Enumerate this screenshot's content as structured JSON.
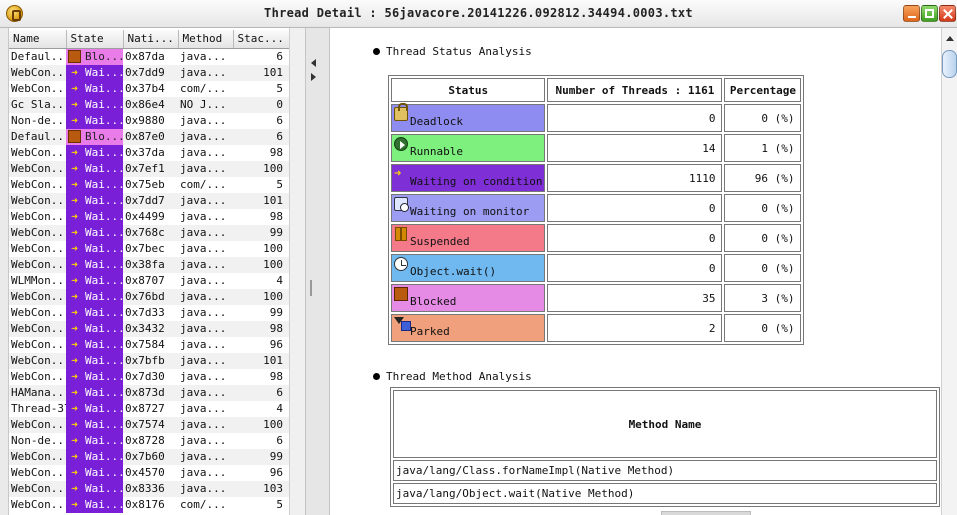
{
  "window": {
    "title": "Thread Detail : 56javacore.20141226.092812.34494.0003.txt"
  },
  "colors": {
    "blocked_state_bg": "#e97ce9",
    "waiting_state_bg": "#7a1fd8",
    "deadlock_bg": "#8f8cf1",
    "runnable_bg": "#7ef07e",
    "waiting_condition_bg": "#7f2fd6",
    "waiting_monitor_bg": "#9c9cf3",
    "suspended_bg": "#f47a8a",
    "object_wait_bg": "#6fb9f0",
    "blocked_bg": "#e58be5",
    "parked_bg": "#f0a07c"
  },
  "thread_table": {
    "columns": [
      "Name",
      "State",
      "Nati...",
      "Method",
      "Stac..."
    ],
    "rows": [
      {
        "name": "Defaul...",
        "state": "Blo...",
        "state_type": "blocked",
        "native": "0x87da",
        "method": "java...",
        "stack": "6"
      },
      {
        "name": "WebCon...",
        "state": "Wai...",
        "state_type": "waiting",
        "native": "0x7dd9",
        "method": "java...",
        "stack": "101"
      },
      {
        "name": "WebCon...",
        "state": "Wai...",
        "state_type": "waiting",
        "native": "0x37b4",
        "method": "com/...",
        "stack": "5"
      },
      {
        "name": "Gc Sla...",
        "state": "Wai...",
        "state_type": "waiting",
        "native": "0x86e4",
        "method": "NO J...",
        "stack": "0"
      },
      {
        "name": "Non-de...",
        "state": "Wai...",
        "state_type": "waiting",
        "native": "0x9880",
        "method": "java...",
        "stack": "6"
      },
      {
        "name": "Defaul...",
        "state": "Blo...",
        "state_type": "blocked",
        "native": "0x87e0",
        "method": "java...",
        "stack": "6"
      },
      {
        "name": "WebCon...",
        "state": "Wai...",
        "state_type": "waiting",
        "native": "0x37da",
        "method": "java...",
        "stack": "98"
      },
      {
        "name": "WebCon...",
        "state": "Wai...",
        "state_type": "waiting",
        "native": "0x7ef1",
        "method": "java...",
        "stack": "100"
      },
      {
        "name": "WebCon...",
        "state": "Wai...",
        "state_type": "waiting",
        "native": "0x75eb",
        "method": "com/...",
        "stack": "5"
      },
      {
        "name": "WebCon...",
        "state": "Wai...",
        "state_type": "waiting",
        "native": "0x7dd7",
        "method": "java...",
        "stack": "101"
      },
      {
        "name": "WebCon...",
        "state": "Wai...",
        "state_type": "waiting",
        "native": "0x4499",
        "method": "java...",
        "stack": "98"
      },
      {
        "name": "WebCon...",
        "state": "Wai...",
        "state_type": "waiting",
        "native": "0x768c",
        "method": "java...",
        "stack": "99"
      },
      {
        "name": "WebCon...",
        "state": "Wai...",
        "state_type": "waiting",
        "native": "0x7bec",
        "method": "java...",
        "stack": "100"
      },
      {
        "name": "WebCon...",
        "state": "Wai...",
        "state_type": "waiting",
        "native": "0x38fa",
        "method": "java...",
        "stack": "100"
      },
      {
        "name": "WLMMon...",
        "state": "Wai...",
        "state_type": "waiting",
        "native": "0x8707",
        "method": "java...",
        "stack": "4"
      },
      {
        "name": "WebCon...",
        "state": "Wai...",
        "state_type": "waiting",
        "native": "0x76bd",
        "method": "java...",
        "stack": "100"
      },
      {
        "name": "WebCon...",
        "state": "Wai...",
        "state_type": "waiting",
        "native": "0x7d33",
        "method": "java...",
        "stack": "99"
      },
      {
        "name": "WebCon...",
        "state": "Wai...",
        "state_type": "waiting",
        "native": "0x3432",
        "method": "java...",
        "stack": "98"
      },
      {
        "name": "WebCon...",
        "state": "Wai...",
        "state_type": "waiting",
        "native": "0x7584",
        "method": "java...",
        "stack": "96"
      },
      {
        "name": "WebCon...",
        "state": "Wai...",
        "state_type": "waiting",
        "native": "0x7bfb",
        "method": "java...",
        "stack": "101"
      },
      {
        "name": "WebCon...",
        "state": "Wai...",
        "state_type": "waiting",
        "native": "0x7d30",
        "method": "java...",
        "stack": "98"
      },
      {
        "name": "HAMana...",
        "state": "Wai...",
        "state_type": "waiting",
        "native": "0x873d",
        "method": "java...",
        "stack": "6"
      },
      {
        "name": "Thread-37",
        "state": "Wai...",
        "state_type": "waiting",
        "native": "0x8727",
        "method": "java...",
        "stack": "4"
      },
      {
        "name": "WebCon...",
        "state": "Wai...",
        "state_type": "waiting",
        "native": "0x7574",
        "method": "java...",
        "stack": "100"
      },
      {
        "name": "Non-de...",
        "state": "Wai...",
        "state_type": "waiting",
        "native": "0x8728",
        "method": "java...",
        "stack": "6"
      },
      {
        "name": "WebCon...",
        "state": "Wai...",
        "state_type": "waiting",
        "native": "0x7b60",
        "method": "java...",
        "stack": "99"
      },
      {
        "name": "WebCon...",
        "state": "Wai...",
        "state_type": "waiting",
        "native": "0x4570",
        "method": "java...",
        "stack": "96"
      },
      {
        "name": "WebCon...",
        "state": "Wai...",
        "state_type": "waiting",
        "native": "0x8336",
        "method": "java...",
        "stack": "103"
      },
      {
        "name": "WebCon...",
        "state": "Wai...",
        "state_type": "waiting",
        "native": "0x8176",
        "method": "com/...",
        "stack": "5"
      }
    ]
  },
  "status_analysis": {
    "heading": "Thread Status Analysis",
    "headers": {
      "status": "Status",
      "number": "Number of Threads : 1161",
      "percentage": "Percentage"
    },
    "rows": [
      {
        "label": "Deadlock",
        "icon": "lock-icon",
        "count": "0",
        "percent": "0 (%)"
      },
      {
        "label": "Runnable",
        "icon": "play-icon",
        "count": "14",
        "percent": "1 (%)"
      },
      {
        "label": "Waiting on condition",
        "icon": "arrow-right-icon",
        "count": "1110",
        "percent": "96 (%)"
      },
      {
        "label": "Waiting on monitor",
        "icon": "monitor-icon",
        "count": "0",
        "percent": "0 (%)"
      },
      {
        "label": "Suspended",
        "icon": "pause-icon",
        "count": "0",
        "percent": "0 (%)"
      },
      {
        "label": "Object.wait()",
        "icon": "clock-icon",
        "count": "0",
        "percent": "0 (%)"
      },
      {
        "label": "Blocked",
        "icon": "blocked-square-icon",
        "count": "35",
        "percent": "3 (%)"
      },
      {
        "label": "Parked",
        "icon": "hourglass-icon",
        "count": "2",
        "percent": "0 (%)"
      }
    ]
  },
  "method_analysis": {
    "heading": "Thread Method Analysis",
    "header": "Method Name",
    "rows": [
      "java/lang/Class.forNameImpl(Native Method)",
      "java/lang/Object.wait(Native Method)"
    ]
  }
}
